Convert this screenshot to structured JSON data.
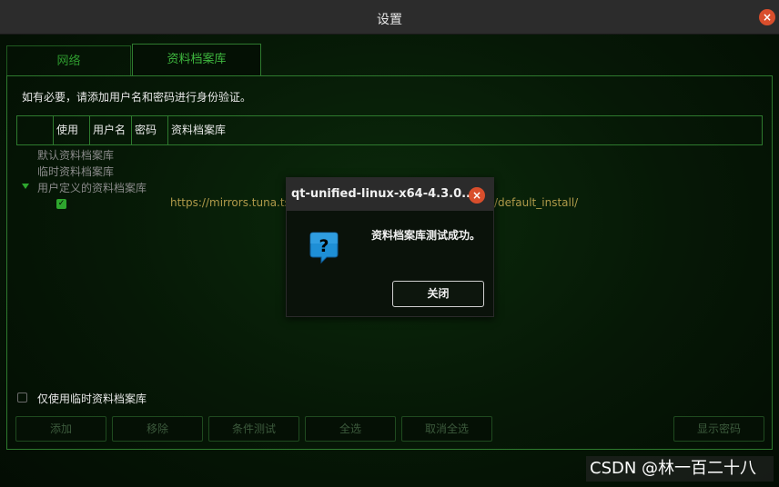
{
  "window": {
    "title": "设置",
    "close": "×"
  },
  "tabs": [
    {
      "label": "网络",
      "active": false
    },
    {
      "label": "资料档案库",
      "active": true
    }
  ],
  "help_text": "如有必要，请添加用户名和密码进行身份验证。",
  "table": {
    "headers": [
      "",
      "使用",
      "用户名",
      "密码",
      "资料档案库"
    ]
  },
  "tree": {
    "default_repo": "默认资料档案库",
    "temp_repo": "临时资料档案库",
    "user_repo": "用户定义的资料档案库",
    "url_start": "https://mirrors.tuna.tsi",
    "url_end": "/default_install/",
    "checked_mark": "✓"
  },
  "temp_only_label": "仅使用临时资料档案库",
  "buttons": {
    "add": "添加",
    "remove": "移除",
    "test": "条件测试",
    "select_all": "全选",
    "deselect_all": "取消全选",
    "show_password": "显示密码"
  },
  "dialog": {
    "title": "qt-unified-linux-x64-4.3.0...",
    "close": "×",
    "icon": "question-icon",
    "message": "资料档案库测试成功。",
    "ok_label": "关闭"
  },
  "watermark": "CSDN @林一百二十八",
  "colors": {
    "accent_green": "#2ea62e",
    "close_red": "#d94e2c",
    "url_text": "#b09a4a",
    "icon_blue": "#1e8fd6"
  }
}
